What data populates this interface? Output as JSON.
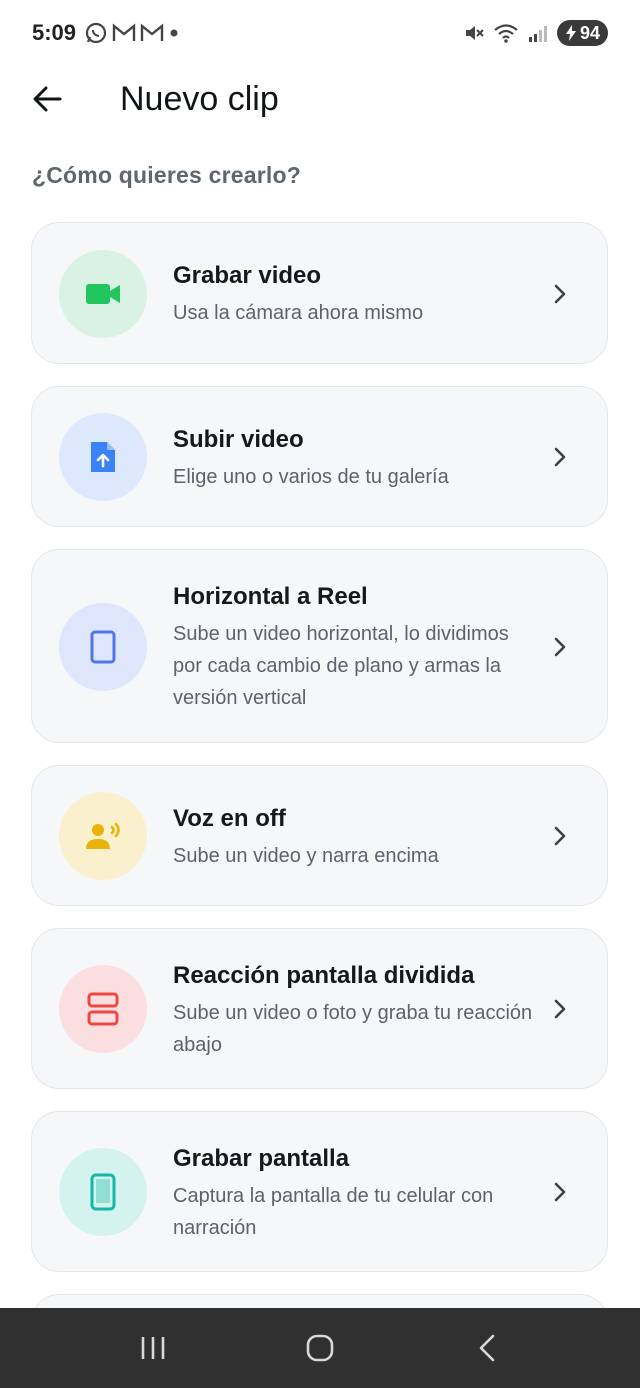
{
  "status": {
    "time": "5:09",
    "battery": "94"
  },
  "header": {
    "title": "Nuevo clip"
  },
  "prompt": "¿Cómo quieres crearlo?",
  "options": [
    {
      "title": "Grabar video",
      "desc": "Usa la cámara ahora mismo",
      "icon": "video-camera-icon",
      "icon_color": "#22c55e",
      "bg": "#d9f2e3"
    },
    {
      "title": "Subir video",
      "desc": "Elige uno o varios de tu galería",
      "icon": "upload-file-icon",
      "icon_color": "#3b82f6",
      "bg": "#dce8fb"
    },
    {
      "title": "Horizontal a Reel",
      "desc": "Sube un video horizontal, lo dividimos por cada cambio de plano y armas la versión vertical",
      "icon": "vertical-frame-icon",
      "icon_color": "#4f77e3",
      "bg": "#dfe6fb"
    },
    {
      "title": "Voz en off",
      "desc": "Sube un video y narra encima",
      "icon": "voice-over-icon",
      "icon_color": "#eab308",
      "bg": "#fbf0cd"
    },
    {
      "title": "Reacción pantalla dividida",
      "desc": "Sube un video o foto y graba tu reacción abajo",
      "icon": "split-screen-icon",
      "icon_color": "#ef4444",
      "bg": "#fbdfe0"
    },
    {
      "title": "Grabar pantalla",
      "desc": "Captura la pantalla de tu celular con narración",
      "icon": "phone-screen-icon",
      "icon_color": "#14b8a6",
      "bg": "#d4f3ef"
    }
  ]
}
